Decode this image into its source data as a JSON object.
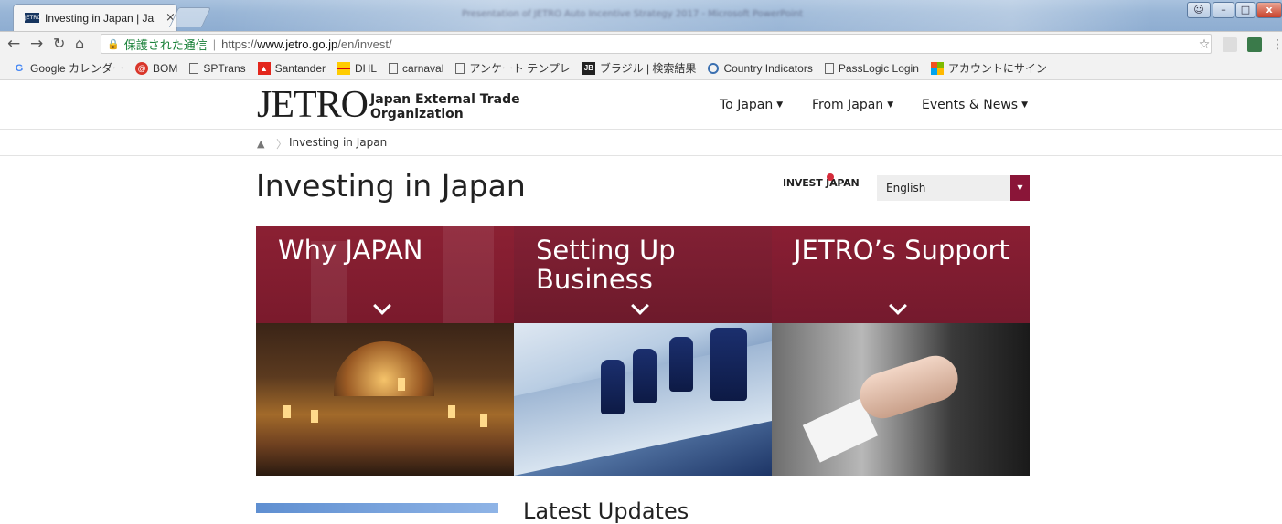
{
  "browser": {
    "tab_title": "Investing in Japan | Ja",
    "tab_favicon": "JETRO",
    "window_title_blurred": "Presentation of JETRO Auto Incentive Strategy 2017 - Microsoft PowerPoint",
    "address": {
      "secure_label": "保護された通信",
      "scheme": "https://",
      "host": "www.jetro.go.jp",
      "path": "/en/invest/"
    },
    "bookmarks": [
      {
        "label": "Google カレンダー",
        "icon": "google-icon"
      },
      {
        "label": "BOM",
        "icon": "bom-icon"
      },
      {
        "label": "SPTrans",
        "icon": "page-icon"
      },
      {
        "label": "Santander",
        "icon": "santander-icon"
      },
      {
        "label": "DHL",
        "icon": "dhl-icon"
      },
      {
        "label": "carnaval",
        "icon": "page-icon"
      },
      {
        "label": "アンケート テンプレ",
        "icon": "page-icon"
      },
      {
        "label": "ブラジル | 検索結果",
        "icon": "jb-icon"
      },
      {
        "label": "Country Indicators",
        "icon": "circle-icon"
      },
      {
        "label": "PassLogic Login",
        "icon": "page-icon"
      },
      {
        "label": "アカウントにサイン",
        "icon": "microsoft-icon"
      }
    ]
  },
  "header": {
    "logo_mark": "JETRO",
    "logo_line1": "Japan External Trade",
    "logo_line2": "Organization",
    "nav": [
      {
        "label": "To Japan"
      },
      {
        "label": "From Japan"
      },
      {
        "label": "Events & News"
      }
    ]
  },
  "breadcrumb": {
    "current": "Investing in Japan"
  },
  "main": {
    "title": "Investing in Japan",
    "invest_logo": "INVEST JAPAN",
    "language": "English",
    "tiles": [
      {
        "label": "Why JAPAN"
      },
      {
        "label": "Setting Up Business"
      },
      {
        "label": "JETRO’s Support"
      }
    ],
    "updates_title": "Latest Updates"
  },
  "colors": {
    "brand_maroon": "#7f1a2d",
    "select_arrow": "#8a1538",
    "secure_green": "#188038"
  }
}
